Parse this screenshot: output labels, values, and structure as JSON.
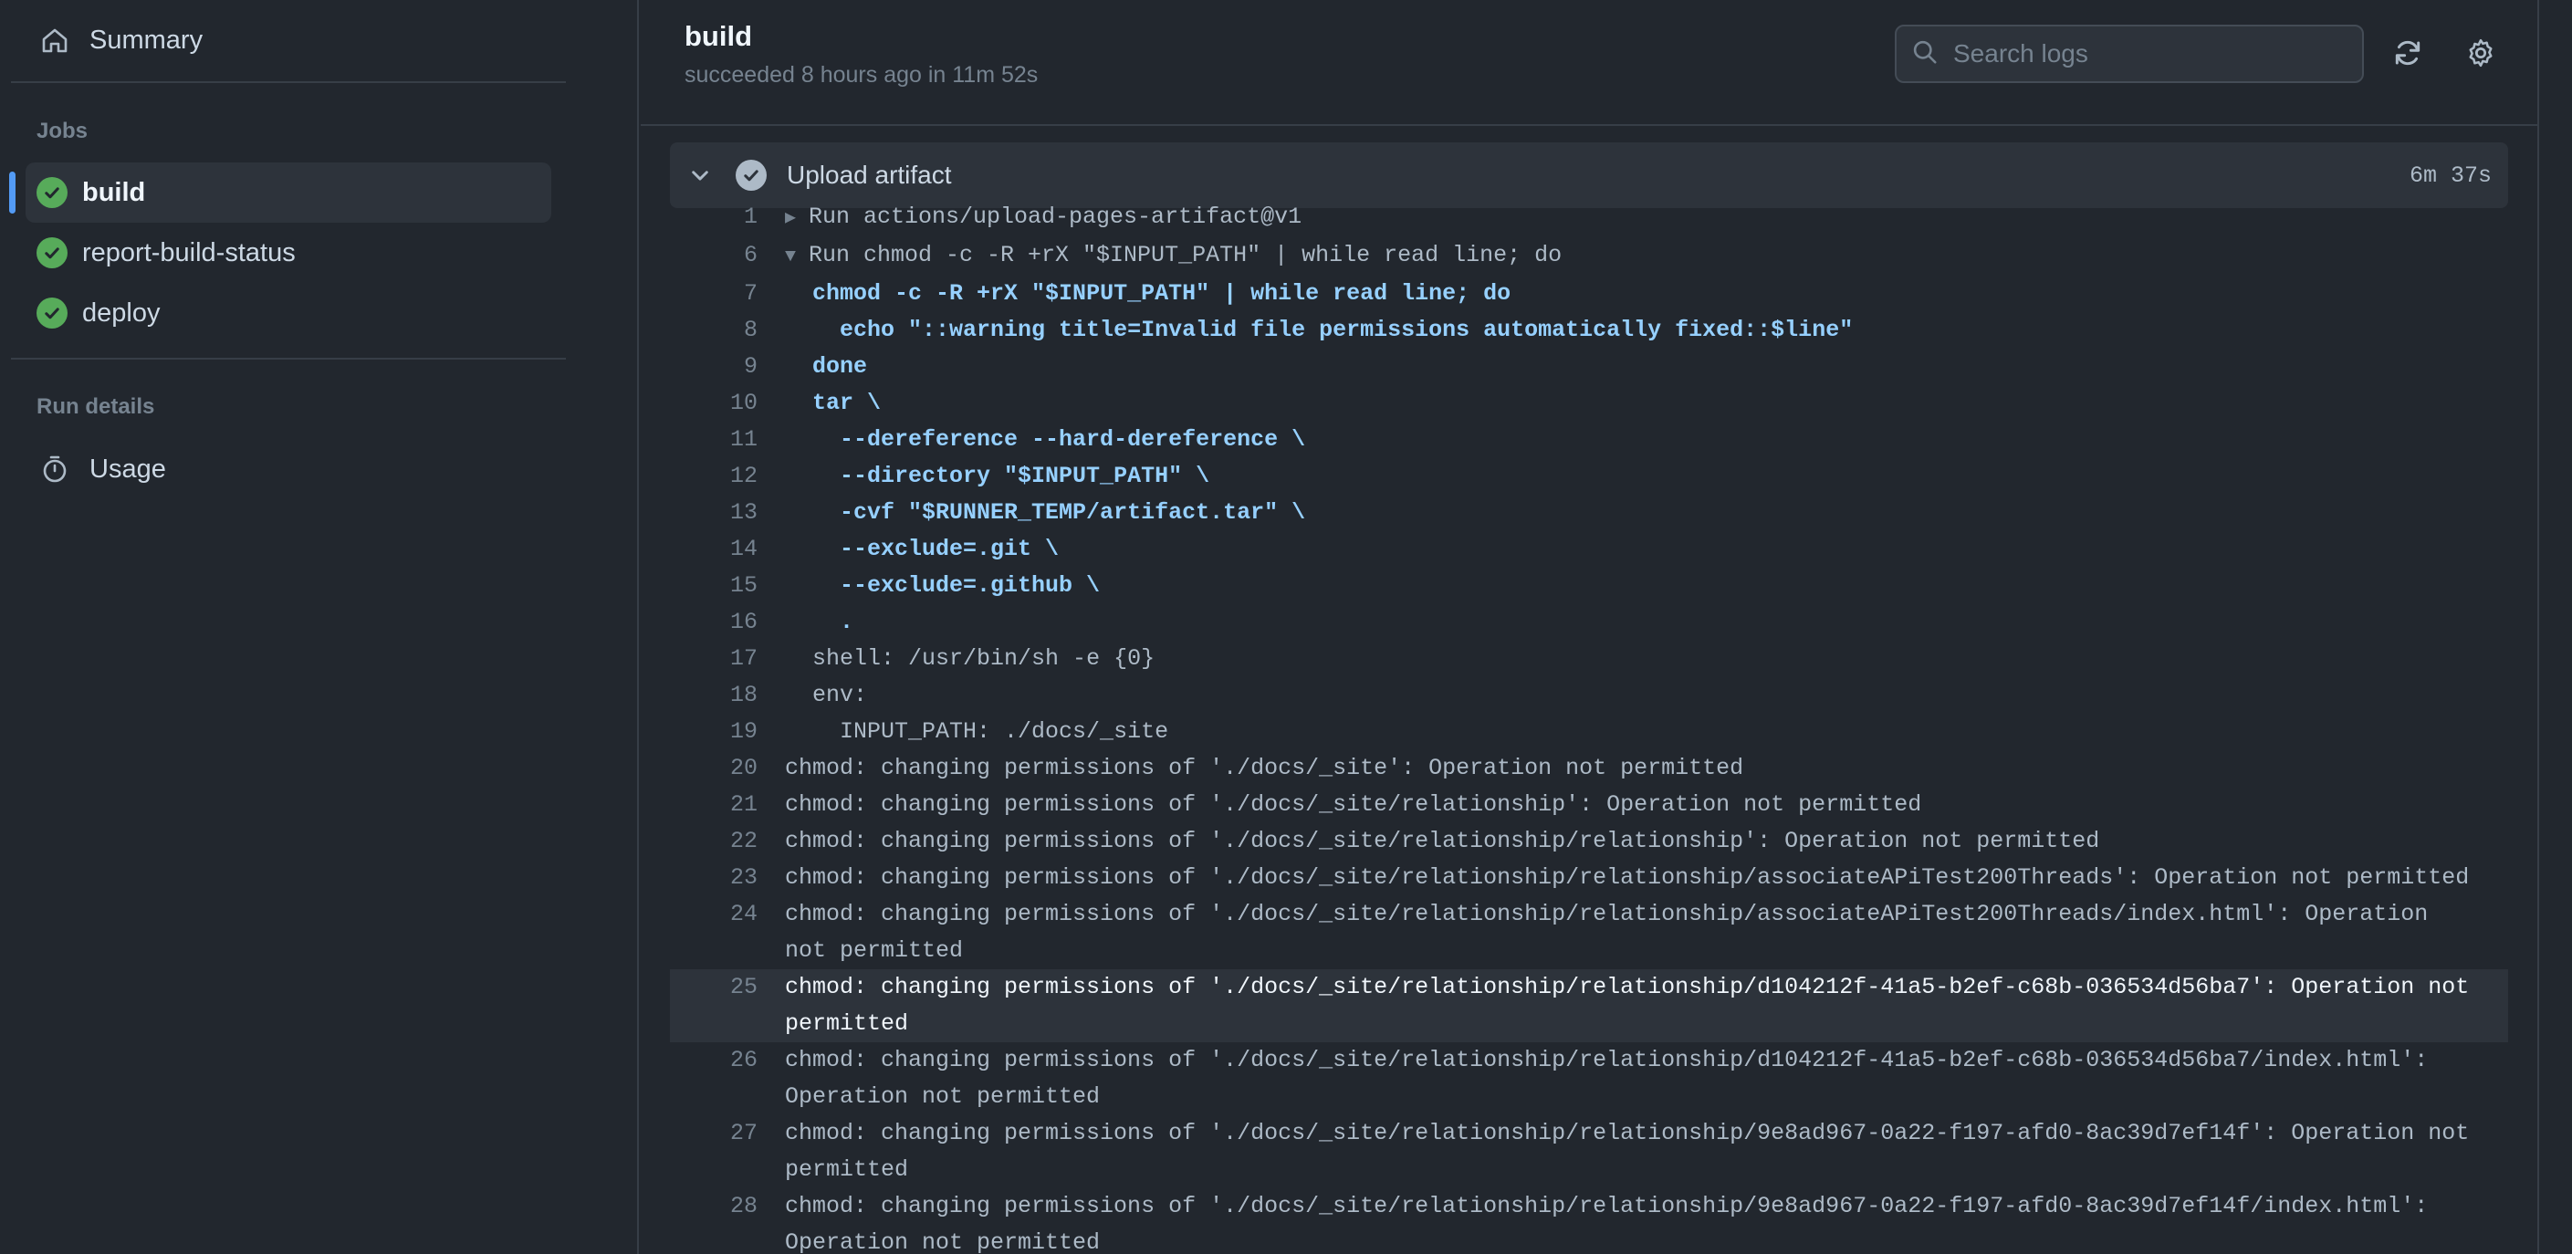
{
  "sidebar": {
    "summary_label": "Summary",
    "jobs_heading": "Jobs",
    "jobs": [
      {
        "label": "build",
        "status": "success",
        "active": true
      },
      {
        "label": "report-build-status",
        "status": "success",
        "active": false
      },
      {
        "label": "deploy",
        "status": "success",
        "active": false
      }
    ],
    "run_details_heading": "Run details",
    "usage_label": "Usage"
  },
  "header": {
    "title": "build",
    "subtitle": "succeeded 8 hours ago in 11m 52s",
    "search_placeholder": "Search logs"
  },
  "step": {
    "name": "Upload artifact",
    "duration": "6m 37s"
  },
  "log": {
    "lines": [
      {
        "n": "1",
        "text": "Run actions/upload-pages-artifact@v1",
        "kind": "group-collapsed"
      },
      {
        "n": "6",
        "text": "Run chmod -c -R +rX \"$INPUT_PATH\" | while read line; do",
        "kind": "group-expanded"
      },
      {
        "n": "7",
        "text": "  chmod -c -R +rX \"$INPUT_PATH\" | while read line; do",
        "kind": "cmd"
      },
      {
        "n": "8",
        "text": "    echo \"::warning title=Invalid file permissions automatically fixed::$line\"",
        "kind": "cmd"
      },
      {
        "n": "9",
        "text": "  done",
        "kind": "cmd"
      },
      {
        "n": "10",
        "text": "  tar \\",
        "kind": "cmd"
      },
      {
        "n": "11",
        "text": "    --dereference --hard-dereference \\",
        "kind": "cmd"
      },
      {
        "n": "12",
        "text": "    --directory \"$INPUT_PATH\" \\",
        "kind": "cmd"
      },
      {
        "n": "13",
        "text": "    -cvf \"$RUNNER_TEMP/artifact.tar\" \\",
        "kind": "cmd"
      },
      {
        "n": "14",
        "text": "    --exclude=.git \\",
        "kind": "cmd"
      },
      {
        "n": "15",
        "text": "    --exclude=.github \\",
        "kind": "cmd"
      },
      {
        "n": "16",
        "text": "    .",
        "kind": "cmd"
      },
      {
        "n": "17",
        "text": "  shell: /usr/bin/sh -e {0}",
        "kind": "plain"
      },
      {
        "n": "18",
        "text": "  env:",
        "kind": "plain"
      },
      {
        "n": "19",
        "text": "    INPUT_PATH: ./docs/_site",
        "kind": "plain"
      },
      {
        "n": "20",
        "text": "chmod: changing permissions of './docs/_site': Operation not permitted",
        "kind": "plain"
      },
      {
        "n": "21",
        "text": "chmod: changing permissions of './docs/_site/relationship': Operation not permitted",
        "kind": "plain"
      },
      {
        "n": "22",
        "text": "chmod: changing permissions of './docs/_site/relationship/relationship': Operation not permitted",
        "kind": "plain"
      },
      {
        "n": "23",
        "text": "chmod: changing permissions of './docs/_site/relationship/relationship/associateAPiTest200Threads': Operation not permitted",
        "kind": "plain"
      },
      {
        "n": "24",
        "text": "chmod: changing permissions of './docs/_site/relationship/relationship/associateAPiTest200Threads/index.html': Operation not permitted",
        "kind": "plain"
      },
      {
        "n": "25",
        "text": "chmod: changing permissions of './docs/_site/relationship/relationship/d104212f-41a5-b2ef-c68b-036534d56ba7': Operation not permitted",
        "kind": "highlight"
      },
      {
        "n": "26",
        "text": "chmod: changing permissions of './docs/_site/relationship/relationship/d104212f-41a5-b2ef-c68b-036534d56ba7/index.html': Operation not permitted",
        "kind": "plain"
      },
      {
        "n": "27",
        "text": "chmod: changing permissions of './docs/_site/relationship/relationship/9e8ad967-0a22-f197-afd0-8ac39d7ef14f': Operation not permitted",
        "kind": "plain"
      },
      {
        "n": "28",
        "text": "chmod: changing permissions of './docs/_site/relationship/relationship/9e8ad967-0a22-f197-afd0-8ac39d7ef14f/index.html': Operation not permitted",
        "kind": "plain"
      }
    ]
  },
  "icons": {
    "summary": "home-icon",
    "job_status": "check-circle-icon",
    "usage": "stopwatch-icon",
    "search": "search-icon",
    "refresh": "sync-icon",
    "settings": "gear-icon",
    "collapse": "chevron-down-icon"
  },
  "colors": {
    "background": "#22272e",
    "success": "#57ab5a",
    "accent": "#539bf5",
    "command": "#96d0ff"
  }
}
